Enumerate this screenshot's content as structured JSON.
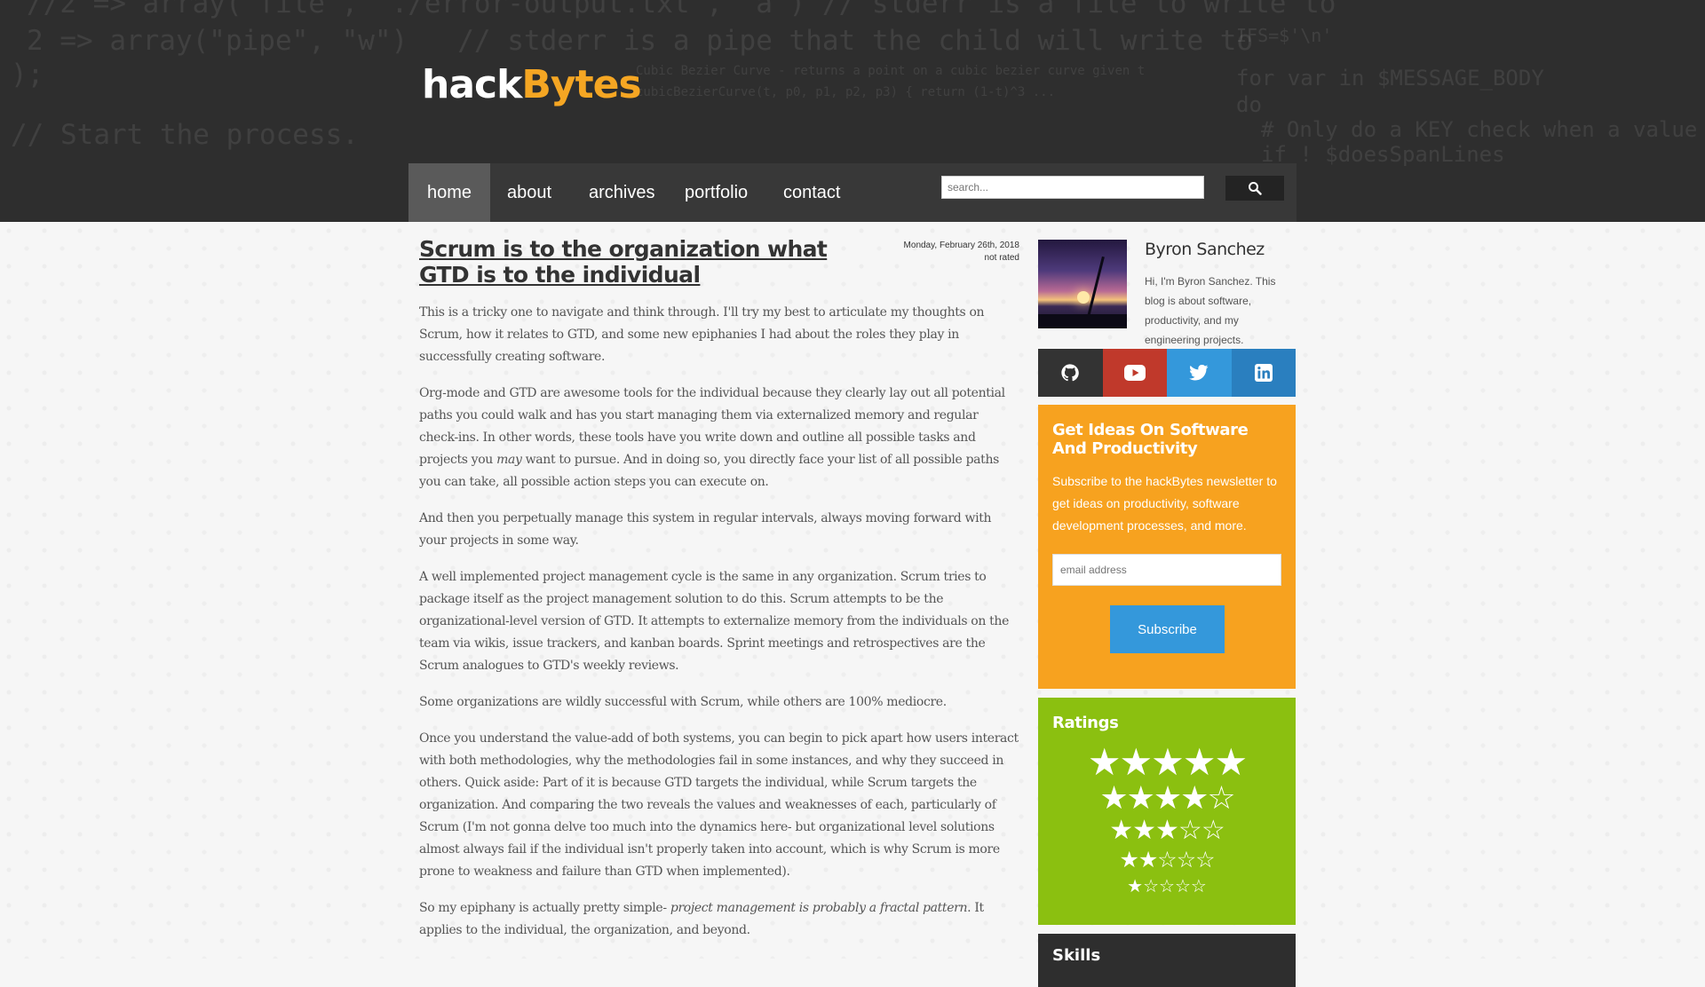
{
  "header": {
    "logo_part1": "hack",
    "logo_part2": "Bytes",
    "code_lines": [
      "//2 => array(\"file\", \"./error-output.txt\", \"a\") // stderr is a file to write to",
      "2 => array(\"pipe\", \"w\")   // stderr is a pipe that the child will write to",
      ");",
      "// Start the process.",
      "for var in $MESSAGE_BODY",
      "do",
      "# Only do a KEY check when a value",
      "if ! $doesSpanLines"
    ],
    "code_small_lines": [
      "Cubic Bezier Curve - returns a point on a cubic bezier curve given t",
      "cubicBezierCurve(t, p0, p1, p2, p3) { return (1-t)^3 ...",
      "IFS=$'\\n'"
    ]
  },
  "nav": {
    "items": [
      "home",
      "about",
      "archives",
      "portfolio",
      "contact"
    ],
    "active": "home",
    "search_placeholder": "search...",
    "search_icon": "search-icon"
  },
  "article": {
    "title": "Scrum is to the organization what GTD is to the individual",
    "date": "Monday, February 26th, 2018",
    "rating": "not rated",
    "paragraphs": [
      "This is a tricky one to navigate and think through. I'll try my best to articulate my thoughts on Scrum, how it relates to GTD, and some new epiphanies I had about the roles they play in successfully creating software.",
      "Org-mode and GTD are awesome tools for the individual because they clearly lay out all potential paths you could walk and has you start managing them via externalized memory and regular check-ins. In other words, these tools have you write down and outline all possible tasks and projects you ",
      "want to pursue. And in doing so, you directly face your list of all possible paths you can take, all possible action steps you can execute on.",
      "And then you perpetually manage this system in regular intervals, always moving forward with your projects in some way.",
      "A well implemented project management cycle is the same in any organization. Scrum tries to package itself as the project management solution to do this. Scrum attempts to be the organizational-level version of GTD. It attempts to externalize memory from the individuals on the team via wikis, issue trackers, and kanban boards. Sprint meetings and retrospectives are the Scrum analogues to GTD's weekly reviews.",
      "Some organizations are wildly successful with Scrum, while others are 100% mediocre.",
      "Once you understand the value-add of both systems, you can begin to pick apart how users interact with both methodologies, why the methodologies fail in some instances, and why they succeed in others. Quick aside: Part of it is because GTD targets the individual, while Scrum targets the organization. And comparing the two reveals the values and weaknesses of each, particularly of Scrum (I'm not gonna delve too much into the dynamics here- but organizational level solutions almost always fail if the individual isn't properly taken into account, which is why Scrum is more prone to weakness and failure than GTD when implemented).",
      "So my epiphany is actually pretty simple- ",
      ". It applies to the individual, the organization, and beyond."
    ],
    "emphasis_may": "may",
    "emphasis_fractal": "project management is probably a fractal pattern"
  },
  "sidebar": {
    "author_name": "Byron Sanchez",
    "author_bio": "Hi, I'm Byron Sanchez. This blog is about software, productivity, and my engineering projects.",
    "social": [
      {
        "name": "github-icon",
        "color": "#333333"
      },
      {
        "name": "youtube-icon",
        "color": "#c0392b"
      },
      {
        "name": "twitter-icon",
        "color": "#3498db"
      },
      {
        "name": "linkedin-icon",
        "color": "#2a7fbf"
      }
    ],
    "newsletter": {
      "title": "Get Ideas On Software And Productivity",
      "text": "Subscribe to the hackBytes newsletter to get ideas on productivity, software development processes, and more.",
      "email_placeholder": "email address",
      "button": "Subscribe",
      "bg": "#f7a21f"
    },
    "ratings": {
      "title": "Ratings",
      "rows": [
        "★★★★★",
        "★★★★☆",
        "★★★☆☆",
        "★★☆☆☆",
        "★☆☆☆☆"
      ],
      "bg": "#8bc010"
    },
    "skills_title": "Skills"
  }
}
